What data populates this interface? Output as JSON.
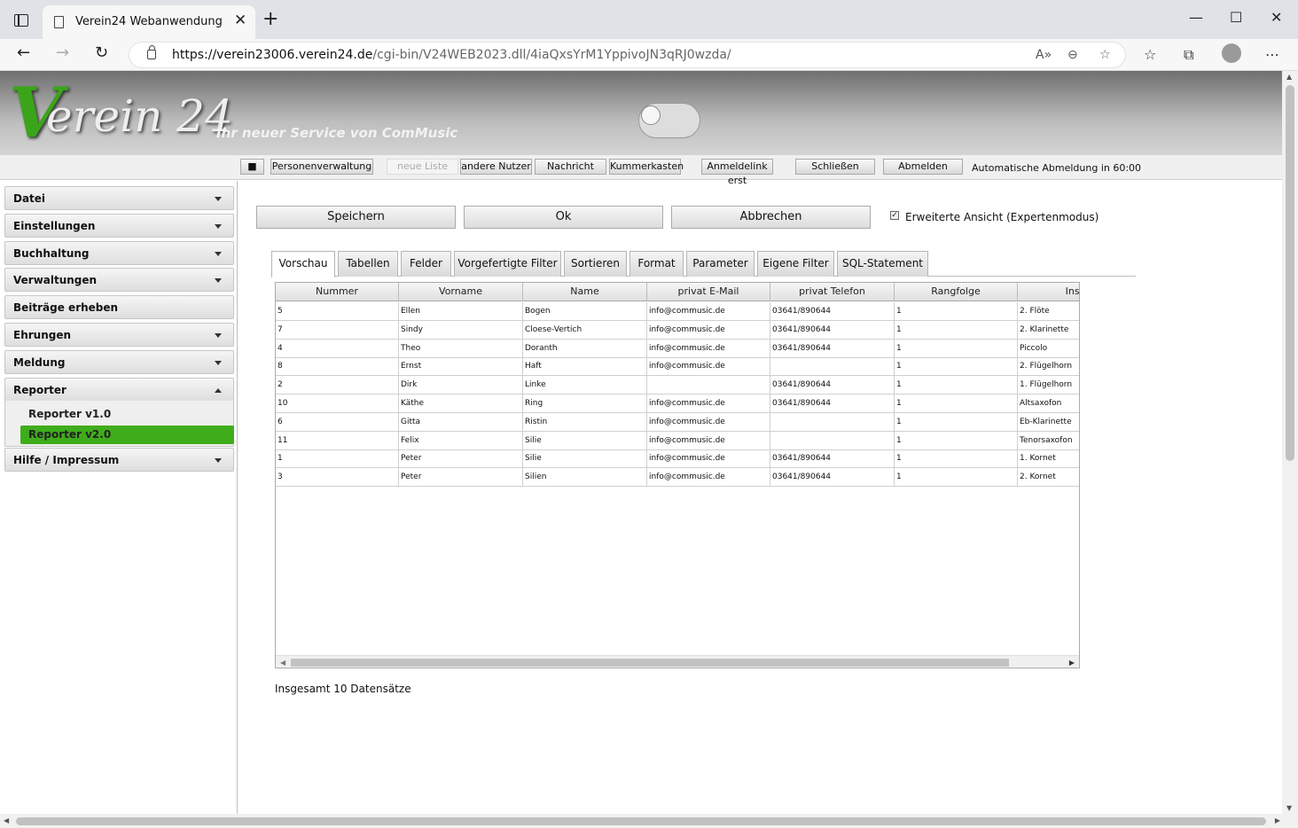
{
  "browser": {
    "tab_title": "Verein24 Webanwendung",
    "url_host": "https://verein23006.verein24.de",
    "url_path": "/cgi-bin/V24WEB2023.dll/4iaQxsYrM1YppivoJN3qRJ0wzda/"
  },
  "banner": {
    "logo_v": "V",
    "logo_rest": "erein 24",
    "tagline": "Ihr neuer Service von ComMusic"
  },
  "topbar": {
    "stop_glyph": "■",
    "buttons": [
      "Personenverwaltung",
      "neue Liste",
      "andere Nutzer",
      "Nachricht",
      "Kummerkasten",
      "Anmeldelink erst",
      "Schließen",
      "Abmelden"
    ],
    "auto_logout": "Automatische Abmeldung in 60:00"
  },
  "sidebar": {
    "items": [
      "Datei",
      "Einstellungen",
      "Buchhaltung",
      "Verwaltungen",
      "Beiträge erheben",
      "Ehrungen",
      "Meldung",
      "Reporter",
      "Hilfe / Impressum"
    ],
    "reporter_sub": [
      "Reporter v1.0",
      "Reporter v2.0"
    ],
    "active_color": "#3fad1b"
  },
  "actions": {
    "save": "Speichern",
    "ok": "Ok",
    "cancel": "Abbrechen",
    "expert_mode": "Erweiterte Ansicht (Expertenmodus)",
    "expert_checked": true
  },
  "tabs": [
    "Vorschau",
    "Tabellen",
    "Felder",
    "Vorgefertigte Filter",
    "Sortieren",
    "Format",
    "Parameter",
    "Eigene Filter",
    "SQL-Statement"
  ],
  "table": {
    "columns": [
      "Nummer",
      "Vorname",
      "Name",
      "privat E-Mail",
      "privat Telefon",
      "Rangfolge",
      "Instru"
    ],
    "rows": [
      [
        "5",
        "Ellen",
        "Bogen",
        "info@commusic.de",
        "03641/890644",
        "1",
        "2. Flöte"
      ],
      [
        "7",
        "Sindy",
        "Cloese-Vertich",
        "info@commusic.de",
        "03641/890644",
        "1",
        "2. Klarinette"
      ],
      [
        "4",
        "Theo",
        "Doranth",
        "info@commusic.de",
        "03641/890644",
        "1",
        "Piccolo"
      ],
      [
        "8",
        "Ernst",
        "Haft",
        "info@commusic.de",
        "",
        "1",
        "2. Flügelhorn"
      ],
      [
        "2",
        "Dirk",
        "Linke",
        "",
        "03641/890644",
        "1",
        "1. Flügelhorn"
      ],
      [
        "10",
        "Käthe",
        "Ring",
        "info@commusic.de",
        "03641/890644",
        "1",
        "Altsaxofon"
      ],
      [
        "6",
        "Gitta",
        "Ristin",
        "info@commusic.de",
        "",
        "1",
        "Eb-Klarinette"
      ],
      [
        "11",
        "Felix",
        "Silie",
        "info@commusic.de",
        "",
        "1",
        "Tenorsaxofon"
      ],
      [
        "1",
        "Peter",
        "Silie",
        "info@commusic.de",
        "03641/890644",
        "1",
        "1. Kornet"
      ],
      [
        "3",
        "Peter",
        "Silien",
        "info@commusic.de",
        "03641/890644",
        "1",
        "2. Kornet"
      ]
    ],
    "total": "Insgesamt 10 Datensätze"
  }
}
